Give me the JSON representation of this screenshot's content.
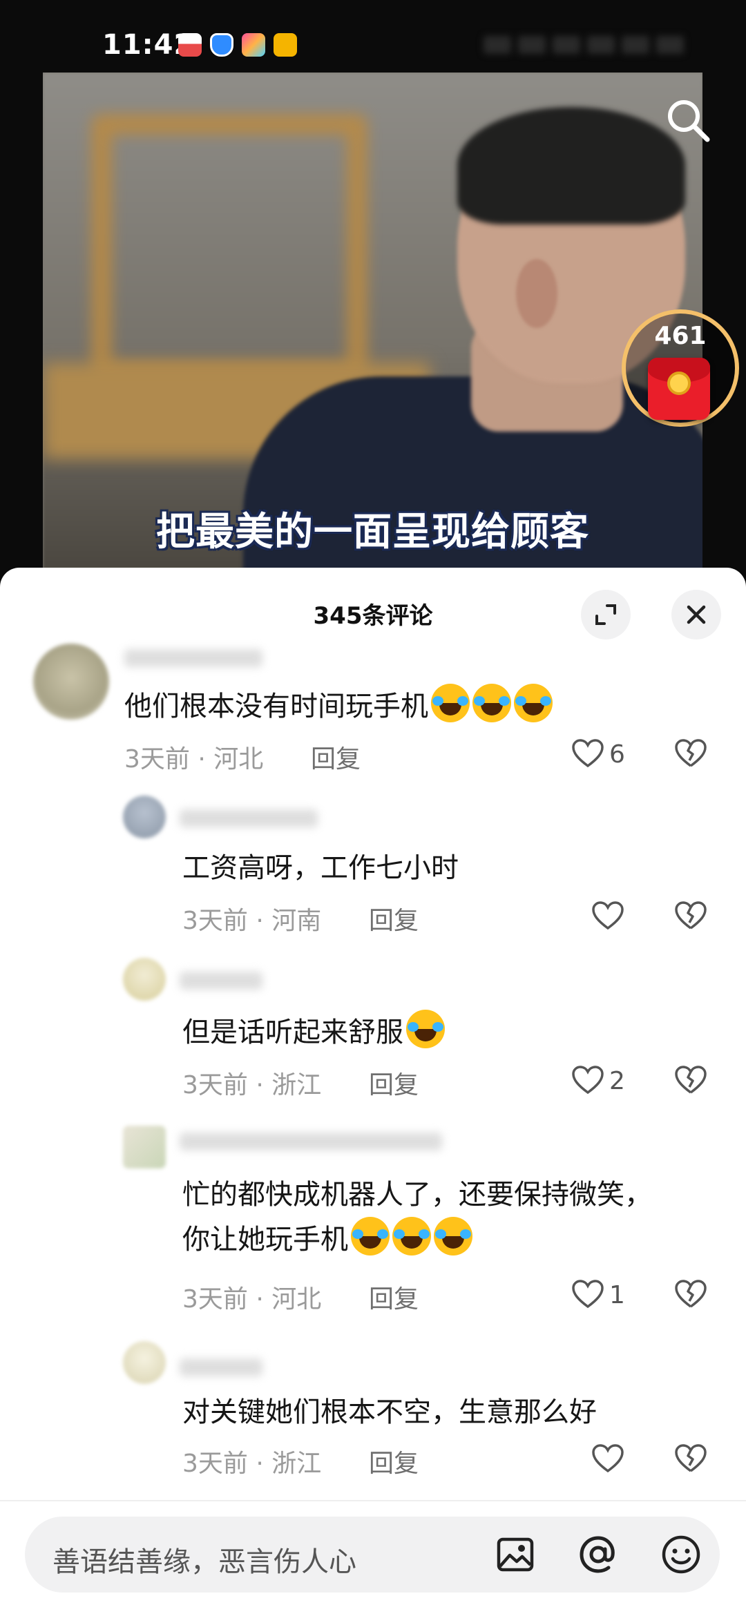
{
  "status_bar": {
    "time": "11:42"
  },
  "video": {
    "subtitle": "把最美的一面呈现给顾客",
    "red_packet_count": "461"
  },
  "comments_sheet": {
    "title": "345条评论",
    "comments": [
      {
        "text": "他们根本没有时间玩手机",
        "emoji_count": 3,
        "time": "3天前",
        "location": "河北",
        "reply": "回复",
        "likes": "6"
      },
      {
        "text": "工资高呀，工作七小时",
        "emoji_count": 0,
        "time": "3天前",
        "location": "河南",
        "reply": "回复",
        "likes": ""
      },
      {
        "text": "但是话听起来舒服",
        "emoji_count": 1,
        "time": "3天前",
        "location": "浙江",
        "reply": "回复",
        "likes": "2"
      },
      {
        "text_line1": "忙的都快成机器人了，还要保持微笑，",
        "text_line2": "你让她玩手机",
        "emoji_count": 3,
        "time": "3天前",
        "location": "河北",
        "reply": "回复",
        "likes": "1"
      },
      {
        "text": "对关键她们根本不空，生意那么好",
        "emoji_count": 0,
        "time": "3天前",
        "location": "浙江",
        "reply": "回复",
        "likes": ""
      }
    ],
    "separator": "·"
  },
  "input": {
    "placeholder": "善语结善缘，恶言伤人心"
  },
  "colors": {
    "accent_red": "#ea1e2a",
    "sheet_bg": "#ffffff",
    "meta_gray": "#9a9a9a"
  }
}
